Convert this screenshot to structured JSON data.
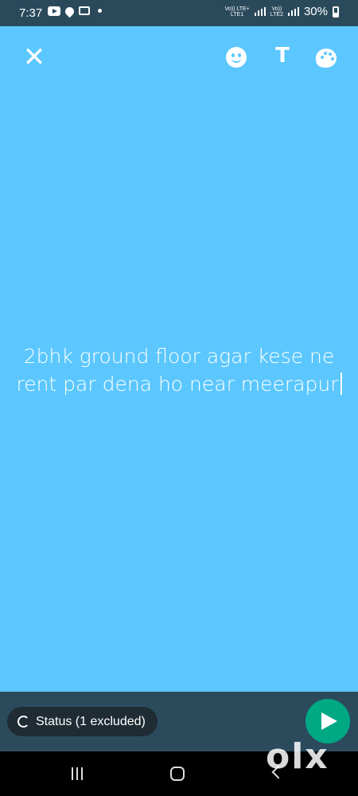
{
  "status_bar": {
    "time": "7:37",
    "network_label_1": "Vo)) LTE+",
    "network_label_1b": "LTE1",
    "network_label_2": "Vo))",
    "network_label_2b": "LTE2",
    "battery": "30%"
  },
  "toolbar": {
    "close_icon": "close-icon",
    "emoji_icon": "emoji-icon",
    "text_icon": "T",
    "palette_icon": "palette-icon"
  },
  "editor": {
    "background_color": "#5bc7fe",
    "text": "2bhk ground floor agar kese ne rent par dena ho near meerapur"
  },
  "bottom_bar": {
    "audience_label": "Status (1 excluded)",
    "send_icon": "send-icon",
    "send_color": "#00a884"
  },
  "watermark": {
    "text": "olx"
  }
}
